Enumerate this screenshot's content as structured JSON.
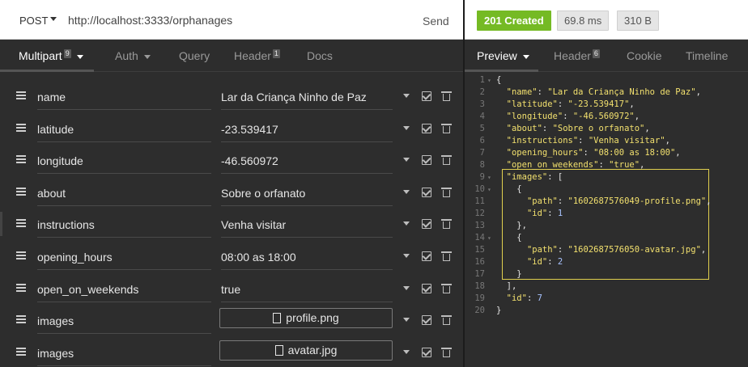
{
  "request": {
    "method": "POST",
    "url": "http://localhost:3333/orphanages",
    "send_label": "Send"
  },
  "left_tabs": [
    {
      "label": "Multipart",
      "badge": "9",
      "active": true,
      "has_caret": true
    },
    {
      "label": "Auth",
      "badge": "",
      "active": false,
      "has_caret": true
    },
    {
      "label": "Query",
      "badge": "",
      "active": false,
      "has_caret": false
    },
    {
      "label": "Header",
      "badge": "1",
      "active": false,
      "has_caret": false
    },
    {
      "label": "Docs",
      "badge": "",
      "active": false,
      "has_caret": false
    }
  ],
  "fields": [
    {
      "name": "name",
      "value": "Lar da Criança Ninho de Paz",
      "type": "text"
    },
    {
      "name": "latitude",
      "value": "-23.539417",
      "type": "text"
    },
    {
      "name": "longitude",
      "value": "-46.560972",
      "type": "text"
    },
    {
      "name": "about",
      "value": "Sobre o orfanato",
      "type": "text"
    },
    {
      "name": "instructions",
      "value": "Venha visitar",
      "type": "text"
    },
    {
      "name": "opening_hours",
      "value": "08:00 as 18:00",
      "type": "text"
    },
    {
      "name": "open_on_weekends",
      "value": "true",
      "type": "text"
    },
    {
      "name": "images",
      "value": "profile.png",
      "type": "file"
    },
    {
      "name": "images",
      "value": "avatar.jpg",
      "type": "file"
    }
  ],
  "response": {
    "status": "201 Created",
    "status_color": "#75ba24",
    "time": "69.8 ms",
    "size": "310 B"
  },
  "right_tabs": [
    {
      "label": "Preview",
      "badge": "",
      "active": true,
      "has_caret": true
    },
    {
      "label": "Header",
      "badge": "6",
      "active": false,
      "has_caret": false
    },
    {
      "label": "Cookie",
      "badge": "",
      "active": false,
      "has_caret": false
    },
    {
      "label": "Timeline",
      "badge": "",
      "active": false,
      "has_caret": false
    }
  ],
  "code_lines": [
    {
      "no": "1",
      "fold": true,
      "parts": [
        [
          "p",
          "{"
        ]
      ]
    },
    {
      "no": "2",
      "fold": false,
      "parts": [
        [
          "p",
          "  "
        ],
        [
          "k",
          "\"name\""
        ],
        [
          "p",
          ": "
        ],
        [
          "s",
          "\"Lar da Criança Ninho de Paz\""
        ],
        [
          "p",
          ","
        ]
      ]
    },
    {
      "no": "3",
      "fold": false,
      "parts": [
        [
          "p",
          "  "
        ],
        [
          "k",
          "\"latitude\""
        ],
        [
          "p",
          ": "
        ],
        [
          "s",
          "\"-23.539417\""
        ],
        [
          "p",
          ","
        ]
      ]
    },
    {
      "no": "4",
      "fold": false,
      "parts": [
        [
          "p",
          "  "
        ],
        [
          "k",
          "\"longitude\""
        ],
        [
          "p",
          ": "
        ],
        [
          "s",
          "\"-46.560972\""
        ],
        [
          "p",
          ","
        ]
      ]
    },
    {
      "no": "5",
      "fold": false,
      "parts": [
        [
          "p",
          "  "
        ],
        [
          "k",
          "\"about\""
        ],
        [
          "p",
          ": "
        ],
        [
          "s",
          "\"Sobre o orfanato\""
        ],
        [
          "p",
          ","
        ]
      ]
    },
    {
      "no": "6",
      "fold": false,
      "parts": [
        [
          "p",
          "  "
        ],
        [
          "k",
          "\"instructions\""
        ],
        [
          "p",
          ": "
        ],
        [
          "s",
          "\"Venha visitar\""
        ],
        [
          "p",
          ","
        ]
      ]
    },
    {
      "no": "7",
      "fold": false,
      "parts": [
        [
          "p",
          "  "
        ],
        [
          "k",
          "\"opening_hours\""
        ],
        [
          "p",
          ": "
        ],
        [
          "s",
          "\"08:00 as 18:00\""
        ],
        [
          "p",
          ","
        ]
      ]
    },
    {
      "no": "8",
      "fold": false,
      "parts": [
        [
          "p",
          "  "
        ],
        [
          "k",
          "\"open_on_weekends\""
        ],
        [
          "p",
          ": "
        ],
        [
          "s",
          "\"true\""
        ],
        [
          "p",
          ","
        ]
      ]
    },
    {
      "no": "9",
      "fold": true,
      "parts": [
        [
          "p",
          "  "
        ],
        [
          "k",
          "\"images\""
        ],
        [
          "p",
          ": ["
        ]
      ]
    },
    {
      "no": "10",
      "fold": true,
      "parts": [
        [
          "p",
          "    {"
        ]
      ]
    },
    {
      "no": "11",
      "fold": false,
      "parts": [
        [
          "p",
          "      "
        ],
        [
          "k",
          "\"path\""
        ],
        [
          "p",
          ": "
        ],
        [
          "s",
          "\"1602687576049-profile.png\""
        ],
        [
          "p",
          ","
        ]
      ]
    },
    {
      "no": "12",
      "fold": false,
      "parts": [
        [
          "p",
          "      "
        ],
        [
          "k",
          "\"id\""
        ],
        [
          "p",
          ": "
        ],
        [
          "n",
          "1"
        ]
      ]
    },
    {
      "no": "13",
      "fold": false,
      "parts": [
        [
          "p",
          "    },"
        ]
      ]
    },
    {
      "no": "14",
      "fold": true,
      "parts": [
        [
          "p",
          "    {"
        ]
      ]
    },
    {
      "no": "15",
      "fold": false,
      "parts": [
        [
          "p",
          "      "
        ],
        [
          "k",
          "\"path\""
        ],
        [
          "p",
          ": "
        ],
        [
          "s",
          "\"1602687576050-avatar.jpg\""
        ],
        [
          "p",
          ","
        ]
      ]
    },
    {
      "no": "16",
      "fold": false,
      "parts": [
        [
          "p",
          "      "
        ],
        [
          "k",
          "\"id\""
        ],
        [
          "p",
          ": "
        ],
        [
          "n",
          "2"
        ]
      ]
    },
    {
      "no": "17",
      "fold": false,
      "parts": [
        [
          "p",
          "    }"
        ]
      ]
    },
    {
      "no": "18",
      "fold": false,
      "parts": [
        [
          "p",
          "  ],"
        ]
      ]
    },
    {
      "no": "19",
      "fold": false,
      "parts": [
        [
          "p",
          "  "
        ],
        [
          "k",
          "\"id\""
        ],
        [
          "p",
          ": "
        ],
        [
          "n",
          "7"
        ]
      ]
    },
    {
      "no": "20",
      "fold": false,
      "parts": [
        [
          "p",
          "}"
        ]
      ]
    }
  ]
}
